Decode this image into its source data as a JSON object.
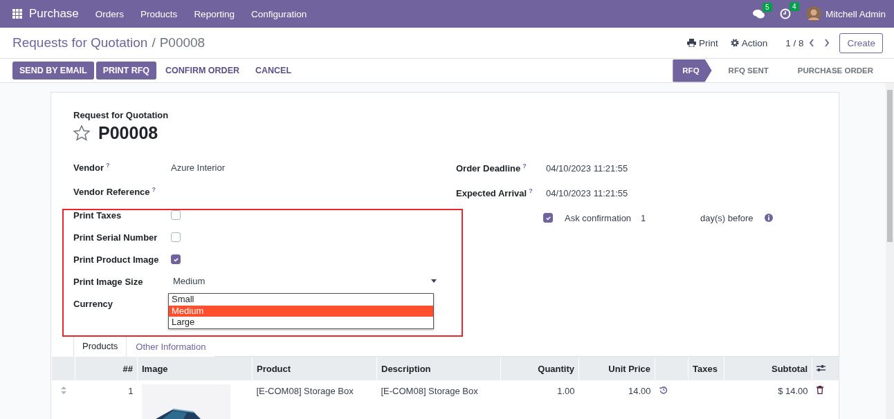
{
  "navbar": {
    "app": "Purchase",
    "menu": [
      "Orders",
      "Products",
      "Reporting",
      "Configuration"
    ],
    "messages_count": "5",
    "activities_count": "4",
    "user": "Mitchell Admin"
  },
  "breadcrumb": {
    "parent": "Requests for Quotation",
    "separator": "/",
    "current": "P00008"
  },
  "toolbar": {
    "print": "Print",
    "action": "Action",
    "pager": "1 / 8",
    "create": "Create"
  },
  "actions": [
    {
      "label": "SEND BY EMAIL",
      "primary": true
    },
    {
      "label": "PRINT RFQ",
      "primary": true
    },
    {
      "label": "CONFIRM ORDER",
      "primary": false
    },
    {
      "label": "CANCEL",
      "primary": false
    }
  ],
  "stages": [
    {
      "label": "RFQ",
      "selected": true
    },
    {
      "label": "RFQ SENT",
      "selected": false
    },
    {
      "label": "PURCHASE ORDER",
      "selected": false
    }
  ],
  "form": {
    "subtitle": "Request for Quotation",
    "name": "P00008",
    "starred": false,
    "highlighted": true,
    "left_fields": [
      {
        "kind": "text",
        "label": "Vendor",
        "help": "?",
        "value": "Azure Interior"
      },
      {
        "kind": "text",
        "label": "Vendor Reference",
        "help": "?"
      },
      {
        "kind": "checkbox",
        "label": "Print Taxes",
        "checked": false
      },
      {
        "kind": "checkbox",
        "label": "Print Serial Number",
        "checked": false
      },
      {
        "kind": "checkbox",
        "label": "Print Product Image",
        "checked": true
      },
      {
        "kind": "select",
        "label": "Print Image Size",
        "value": "Medium",
        "options": [
          {
            "label": "Small",
            "selected": false
          },
          {
            "label": "Medium",
            "selected": true
          },
          {
            "label": "Large",
            "selected": false
          }
        ]
      },
      {
        "kind": "text",
        "label": "Currency"
      }
    ],
    "right_fields": [
      {
        "label": "Order Deadline",
        "help": "?",
        "value": "04/10/2023 11:21:55"
      },
      {
        "label": "Expected Arrival",
        "help": "?",
        "value": "04/10/2023 11:21:55"
      }
    ],
    "ask_confirmation": {
      "checked": true,
      "label": "Ask confirmation",
      "days": "1",
      "suffix": "day(s) before"
    }
  },
  "notebook": {
    "tabs": [
      {
        "label": "Products",
        "selected": true
      },
      {
        "label": "Other Information",
        "selected": false
      }
    ]
  },
  "lines": {
    "columns": [
      "##",
      "Image",
      "Product",
      "Description",
      "Quantity",
      "Unit Price",
      "Taxes",
      "Subtotal"
    ],
    "rows": [
      {
        "seq": "1",
        "product": "[E-COM08] Storage Box",
        "description": "[E-COM08] Storage Box",
        "quantity": "1.00",
        "unit_price": "14.00",
        "subtotal": "$ 14.00"
      }
    ]
  }
}
